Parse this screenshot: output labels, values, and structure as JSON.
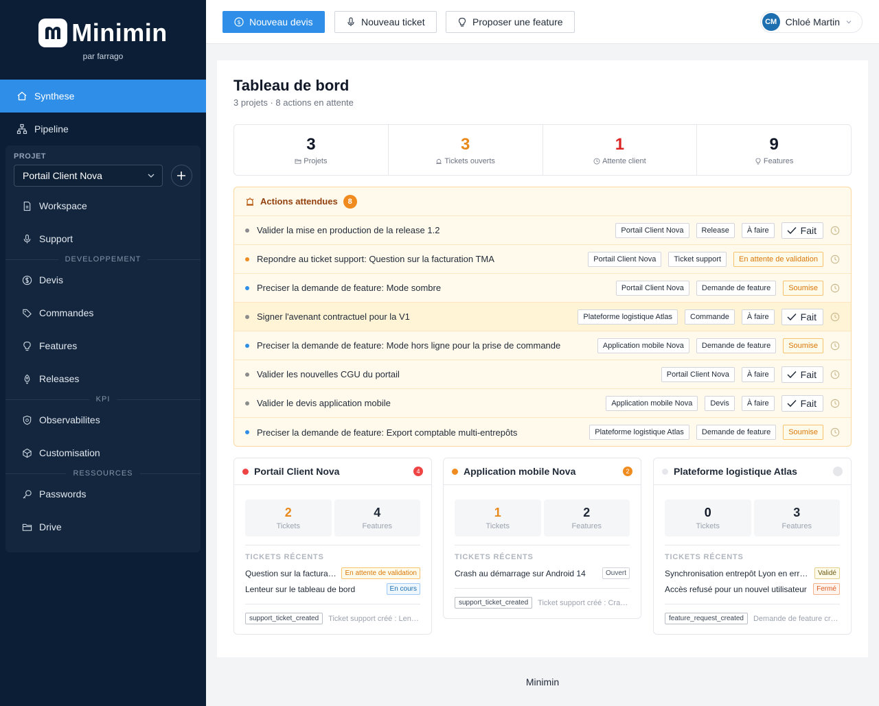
{
  "brand": {
    "name": "Minimin",
    "sub": "par farrago"
  },
  "sidebar": {
    "top_items": [
      {
        "label": "Synthese",
        "icon": "home-icon",
        "active": true
      },
      {
        "label": "Pipeline",
        "icon": "sitemap-icon",
        "active": false
      }
    ],
    "project_label": "PROJET",
    "project_selected": "Portail Client Nova",
    "project_items": [
      {
        "label": "Workspace",
        "icon": "document-icon"
      },
      {
        "label": "Support",
        "icon": "microphone-icon"
      }
    ],
    "sections": [
      {
        "title": "DEVELOPPEMENT",
        "items": [
          {
            "label": "Devis",
            "icon": "dollar-icon"
          },
          {
            "label": "Commandes",
            "icon": "tag-icon"
          },
          {
            "label": "Features",
            "icon": "bulb-icon"
          },
          {
            "label": "Releases",
            "icon": "rocket-icon"
          }
        ]
      },
      {
        "title": "KPI",
        "items": [
          {
            "label": "Observabilites",
            "icon": "shield-icon"
          },
          {
            "label": "Customisation",
            "icon": "cube-icon"
          }
        ]
      },
      {
        "title": "RESSOURCES",
        "items": [
          {
            "label": "Passwords",
            "icon": "key-icon"
          },
          {
            "label": "Drive",
            "icon": "folder-icon"
          }
        ]
      }
    ]
  },
  "topbar": {
    "new_quote": "Nouveau devis",
    "new_ticket": "Nouveau ticket",
    "propose_feature": "Proposer une feature",
    "user_initials": "CM",
    "user_name": "Chloé Martin"
  },
  "dashboard": {
    "title": "Tableau de bord",
    "subtitle": "3 projets · 8 actions en attente",
    "stats": [
      {
        "value": "3",
        "label": "Projets",
        "color": "#111827",
        "icon": "folder-icon"
      },
      {
        "value": "3",
        "label": "Tickets ouverts",
        "color": "#e8891c",
        "icon": "alarm-icon"
      },
      {
        "value": "1",
        "label": "Attente client",
        "color": "#dc2626",
        "icon": "clock-icon"
      },
      {
        "value": "9",
        "label": "Features",
        "color": "#111827",
        "icon": "bulb-icon"
      }
    ],
    "actions_title": "Actions attendues",
    "actions_count": "8",
    "done_label": "Fait",
    "actions": [
      {
        "text": "Valider la mise en production de la release 1.2",
        "dot": "#8c8c8c",
        "project": "Portail Client Nova",
        "type": "Release",
        "status": "À faire",
        "status_warn": false,
        "done": true,
        "hl": false
      },
      {
        "text": "Repondre au ticket support: Question sur la facturation TMA",
        "dot": "#f08c1f",
        "project": "Portail Client Nova",
        "type": "Ticket support",
        "status": "En attente de validation",
        "status_warn": true,
        "done": false,
        "hl": false
      },
      {
        "text": "Preciser la demande de feature: Mode sombre",
        "dot": "#2f8fe8",
        "project": "Portail Client Nova",
        "type": "Demande de feature",
        "status": "Soumise",
        "status_warn": true,
        "done": false,
        "hl": false
      },
      {
        "text": "Signer l'avenant contractuel pour la V1",
        "dot": "#8c8c8c",
        "project": "Plateforme logistique Atlas",
        "type": "Commande",
        "status": "À faire",
        "status_warn": false,
        "done": true,
        "hl": true
      },
      {
        "text": "Preciser la demande de feature: Mode hors ligne pour la prise de commande",
        "dot": "#2f8fe8",
        "project": "Application mobile Nova",
        "type": "Demande de feature",
        "status": "Soumise",
        "status_warn": true,
        "done": false,
        "hl": false
      },
      {
        "text": "Valider les nouvelles CGU du portail",
        "dot": "#8c8c8c",
        "project": "Portail Client Nova",
        "type": null,
        "status": "À faire",
        "status_warn": false,
        "done": true,
        "hl": false
      },
      {
        "text": "Valider le devis application mobile",
        "dot": "#8c8c8c",
        "project": "Application mobile Nova",
        "type": "Devis",
        "status": "À faire",
        "status_warn": false,
        "done": true,
        "hl": false
      },
      {
        "text": "Preciser la demande de feature: Export comptable multi-entrepôts",
        "dot": "#2f8fe8",
        "project": "Plateforme logistique Atlas",
        "type": "Demande de feature",
        "status": "Soumise",
        "status_warn": true,
        "done": false,
        "hl": false
      }
    ],
    "projects": [
      {
        "name": "Portail Client Nova",
        "dot": "#ef4444",
        "badge": "4",
        "badge_color": "#ef4444",
        "tickets": "2",
        "tickets_color": "#e8891c",
        "features": "4",
        "tickets_label": "Tickets",
        "features_label": "Features",
        "recent_title": "TICKETS RÉCENTS",
        "recent": [
          {
            "title": "Question sur la factura…",
            "status": "En attente de validation",
            "cls": "tb-orange"
          },
          {
            "title": "Lenteur sur le tableau de bord",
            "status": "En cours",
            "cls": "tb-blue"
          }
        ],
        "event": "support_ticket_created",
        "event_text": "Ticket support créé : Lent…"
      },
      {
        "name": "Application mobile Nova",
        "dot": "#f08c1f",
        "badge": "2",
        "badge_color": "#f08c1f",
        "tickets": "1",
        "tickets_color": "#e8891c",
        "features": "2",
        "tickets_label": "Tickets",
        "features_label": "Features",
        "recent_title": "TICKETS RÉCENTS",
        "recent": [
          {
            "title": "Crash au démarrage sur Android 14",
            "status": "Ouvert",
            "cls": "tb-grey"
          }
        ],
        "event": "support_ticket_created",
        "event_text": "Ticket support créé : Cra…"
      },
      {
        "name": "Plateforme logistique Atlas",
        "dot": "#e5e7eb",
        "badge": "",
        "badge_color": "#e5e7eb",
        "tickets": "0",
        "tickets_color": "#111827",
        "features": "3",
        "tickets_label": "Tickets",
        "features_label": "Features",
        "recent_title": "TICKETS RÉCENTS",
        "recent": [
          {
            "title": "Synchronisation entrepôt Lyon en err…",
            "status": "Validé",
            "cls": "tb-green"
          },
          {
            "title": "Accès refusé pour un nouvel utilisateur",
            "status": "Fermé",
            "cls": "tb-red"
          }
        ],
        "event": "feature_request_created",
        "event_text": "Demande de feature cr…"
      }
    ]
  },
  "footer": {
    "text": "Minimin"
  }
}
